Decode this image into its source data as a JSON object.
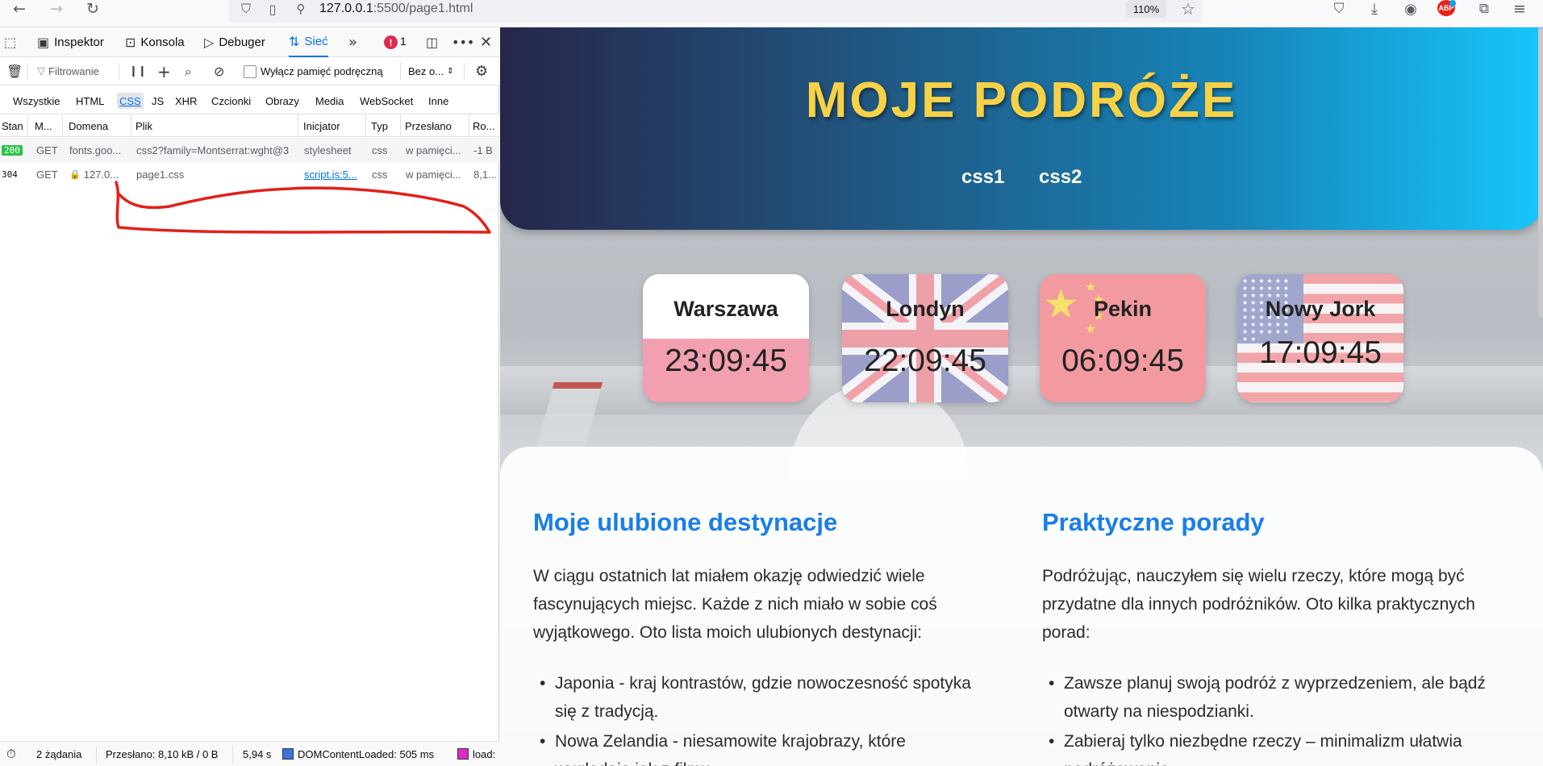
{
  "browser": {
    "url_host": "127.0.0.1",
    "url_path": ":5500/page1.html",
    "zoom": "110%",
    "abp_label": "ABP"
  },
  "devtools": {
    "tabs": [
      "Inspektor",
      "Konsola",
      "Debuger",
      "Sieć"
    ],
    "active_tab": "Sieć",
    "error_count": "1",
    "filter_placeholder": "Filtrowanie",
    "disable_cache_label": "Wyłącz pamięć podręczną",
    "throttle_label": "Bez o...",
    "type_filters": [
      "Wszystkie",
      "HTML",
      "CSS",
      "JS",
      "XHR",
      "Czcionki",
      "Obrazy",
      "Media",
      "WebSocket",
      "Inne"
    ],
    "active_type": "CSS",
    "columns": [
      "Stan",
      "M...",
      "Domena",
      "Plik",
      "Inicjator",
      "Typ",
      "Przesłano",
      "Ro..."
    ],
    "requests": [
      {
        "status": "200",
        "method": "GET",
        "domain": "fonts.goo...",
        "file": "css2?family=Montserrat:wght@3",
        "initiator": "stylesheet",
        "type": "css",
        "transferred": "w pamięci...",
        "size": "-1 B"
      },
      {
        "status": "304",
        "method": "GET",
        "domain": "127.0...",
        "file": "page1.css",
        "initiator": "script.js:5...",
        "type": "css",
        "transferred": "w pamięci...",
        "size": "8,1..."
      }
    ],
    "status_bar": {
      "requests": "2 żądania",
      "transferred": "Przesłano: 8,10 kB / 0 B",
      "time": "5,94 s",
      "dom_loaded": "DOMContentLoaded: 505 ms",
      "load": "load:"
    },
    "colors": {
      "accent": "#0074e8",
      "ok": "#2ac445",
      "error": "#e22850",
      "annotation": "#e0211a"
    }
  },
  "page": {
    "title": "MOJE PODRÓŻE",
    "nav": [
      "css1",
      "css2"
    ],
    "clocks": [
      {
        "city": "Warszawa",
        "time": "23:09:45"
      },
      {
        "city": "Londyn",
        "time": "22:09:45"
      },
      {
        "city": "Pekin",
        "time": "06:09:45"
      },
      {
        "city": "Nowy Jork",
        "time": "17:09:45"
      }
    ],
    "left": {
      "title": "Moje ulubione destynacje",
      "text": "W ciągu ostatnich lat miałem okazję odwiedzić wiele fascynujących miejsc. Każde z nich miało w sobie coś wyjątkowego. Oto lista moich ulubionych destynacji:",
      "items": [
        "Japonia - kraj kontrastów, gdzie nowoczesność spotyka się z tradycją.",
        "Nowa Zelandia - niesamowite krajobrazy, które wyglądają jak z filmu."
      ]
    },
    "right": {
      "title": "Praktyczne porady",
      "text": "Podróżując, nauczyłem się wielu rzeczy, które mogą być przydatne dla innych podróżników. Oto kilka praktycznych porad:",
      "items": [
        "Zawsze planuj swoją podróż z wyprzedzeniem, ale bądź otwarty na niespodzianki.",
        "Zabieraj tylko niezbędne rzeczy – minimalizm ułatwia podróżowanie."
      ]
    },
    "colors": {
      "title_gold": "#f7d246",
      "heading_blue": "#1a7ee8",
      "header_dark": "#27264a",
      "header_light": "#16c6fb"
    }
  }
}
